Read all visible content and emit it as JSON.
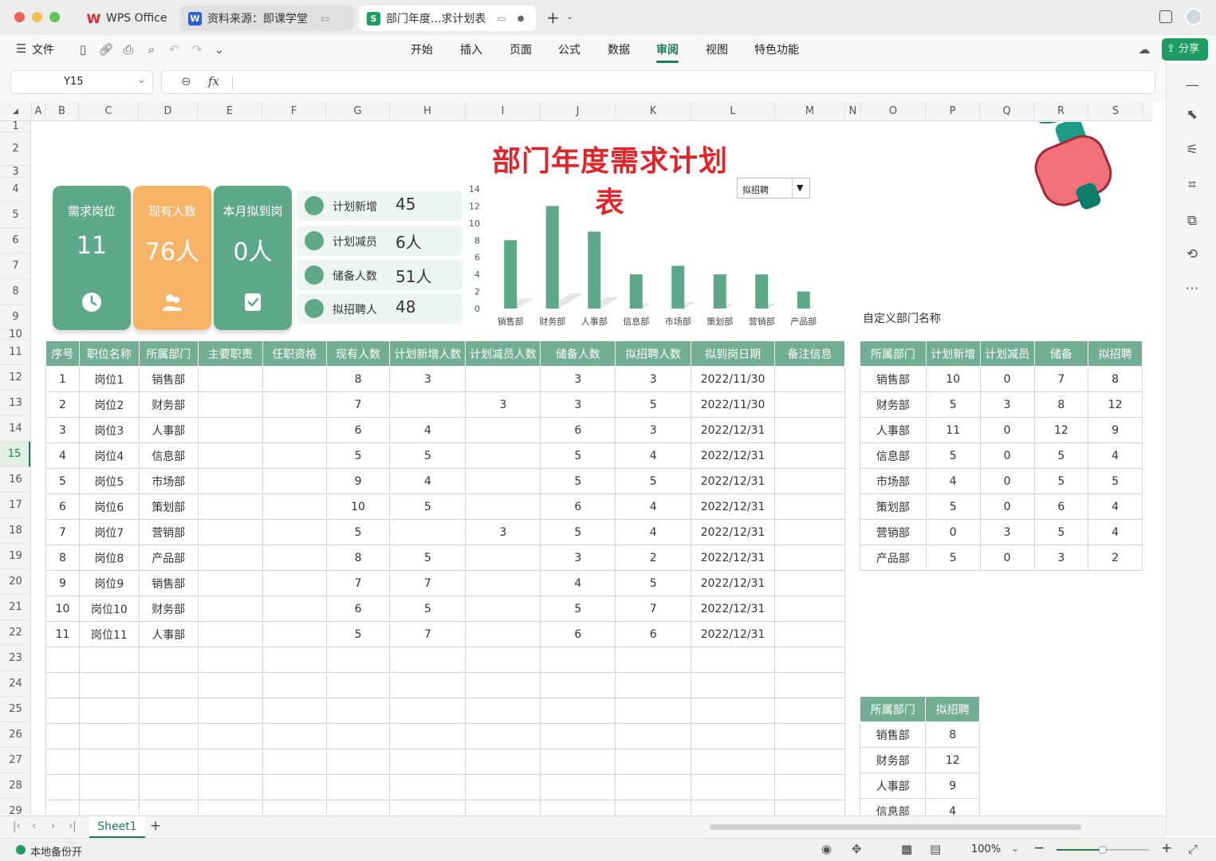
{
  "tabs": [
    {
      "label": "WPS Office",
      "icon": "wps-logo-icon"
    },
    {
      "label": "资料来源：即课学堂",
      "icon": "word-doc-icon"
    },
    {
      "label": "部门年度...求计划表",
      "icon": "sheet-doc-icon"
    }
  ],
  "menu": {
    "file": "文件",
    "items": [
      "开始",
      "插入",
      "页面",
      "公式",
      "数据",
      "审阅",
      "视图",
      "特色功能"
    ],
    "active": "审阅",
    "share": "分享"
  },
  "formula": {
    "cell_ref": "Y15",
    "fx": "fx",
    "value": ""
  },
  "columns": [
    "A",
    "B",
    "C",
    "D",
    "E",
    "F",
    "G",
    "H",
    "I",
    "J",
    "K",
    "L",
    "M",
    "N",
    "O",
    "P",
    "Q",
    "R",
    "S"
  ],
  "rows": [
    "1",
    "2",
    "3",
    "4",
    "5",
    "6",
    "7",
    "8",
    "9",
    "10",
    "11",
    "12",
    "13",
    "14",
    "15",
    "16",
    "17",
    "18",
    "19",
    "20",
    "21",
    "22",
    "23",
    "24",
    "25",
    "26",
    "27",
    "28",
    "29"
  ],
  "selected_row": "15",
  "title": "部门年度需求计划表",
  "kpis": [
    {
      "label": "需求岗位",
      "value": "11",
      "icon": "clock-icon",
      "color": "#5da88a"
    },
    {
      "label": "现有人数",
      "value": "76人",
      "icon": "people-icon",
      "color": "#f8b466"
    },
    {
      "label": "本月拟到岗",
      "value": "0人",
      "icon": "badge-check-icon",
      "color": "#5da88a"
    }
  ],
  "stats": [
    {
      "label": "计划新增",
      "value": "45",
      "icon": "chart-icon"
    },
    {
      "label": "计划减员",
      "value": "6人",
      "icon": "send-icon"
    },
    {
      "label": "储备人数",
      "value": "51人",
      "icon": "paper-plane-icon"
    },
    {
      "label": "拟招聘人",
      "value": "48",
      "icon": "grid-icon"
    }
  ],
  "dropdown": {
    "value": "拟招聘"
  },
  "chart_data": {
    "type": "bar",
    "categories": [
      "销售部",
      "财务部",
      "人事部",
      "信息部",
      "市场部",
      "策划部",
      "营销部",
      "产品部"
    ],
    "values": [
      8,
      12,
      9,
      4,
      5,
      4,
      4,
      2
    ],
    "yticks": [
      "14",
      "12",
      "10",
      "8",
      "6",
      "4",
      "2",
      "0"
    ],
    "ylim": [
      0,
      14
    ],
    "bar_color": "#5da88a"
  },
  "main_table": {
    "headers": [
      "序号",
      "职位名称",
      "所属部门",
      "主要职责",
      "任职资格",
      "现有人数",
      "计划新增人数",
      "计划减员人数",
      "储备人数",
      "拟招聘人数",
      "拟到岗日期",
      "备注信息"
    ],
    "rows": [
      [
        "1",
        "岗位1",
        "销售部",
        "",
        "",
        "8",
        "3",
        "",
        "3",
        "3",
        "2022/11/30",
        ""
      ],
      [
        "2",
        "岗位2",
        "财务部",
        "",
        "",
        "7",
        "",
        "3",
        "3",
        "5",
        "2022/11/30",
        ""
      ],
      [
        "3",
        "岗位3",
        "人事部",
        "",
        "",
        "6",
        "4",
        "",
        "6",
        "3",
        "2022/12/31",
        ""
      ],
      [
        "4",
        "岗位4",
        "信息部",
        "",
        "",
        "5",
        "5",
        "",
        "5",
        "4",
        "2022/12/31",
        ""
      ],
      [
        "5",
        "岗位5",
        "市场部",
        "",
        "",
        "9",
        "4",
        "",
        "5",
        "5",
        "2022/12/31",
        ""
      ],
      [
        "6",
        "岗位6",
        "策划部",
        "",
        "",
        "10",
        "5",
        "",
        "6",
        "4",
        "2022/12/31",
        ""
      ],
      [
        "7",
        "岗位7",
        "营销部",
        "",
        "",
        "5",
        "",
        "3",
        "5",
        "4",
        "2022/12/31",
        ""
      ],
      [
        "8",
        "岗位8",
        "产品部",
        "",
        "",
        "8",
        "5",
        "",
        "3",
        "2",
        "2022/12/31",
        ""
      ],
      [
        "9",
        "岗位9",
        "销售部",
        "",
        "",
        "7",
        "7",
        "",
        "4",
        "5",
        "2022/12/31",
        ""
      ],
      [
        "10",
        "岗位10",
        "财务部",
        "",
        "",
        "6",
        "5",
        "",
        "5",
        "7",
        "2022/12/31",
        ""
      ],
      [
        "11",
        "岗位11",
        "人事部",
        "",
        "",
        "5",
        "7",
        "",
        "6",
        "6",
        "2022/12/31",
        ""
      ]
    ]
  },
  "side_label": "自定义部门名称",
  "dept_table": {
    "headers": [
      "所属部门",
      "计划新增",
      "计划减员",
      "储备",
      "拟招聘"
    ],
    "rows": [
      [
        "销售部",
        "10",
        "0",
        "7",
        "8"
      ],
      [
        "财务部",
        "5",
        "3",
        "8",
        "12"
      ],
      [
        "人事部",
        "11",
        "0",
        "12",
        "9"
      ],
      [
        "信息部",
        "5",
        "0",
        "5",
        "4"
      ],
      [
        "市场部",
        "4",
        "0",
        "5",
        "5"
      ],
      [
        "策划部",
        "5",
        "0",
        "6",
        "4"
      ],
      [
        "营销部",
        "0",
        "3",
        "5",
        "4"
      ],
      [
        "产品部",
        "5",
        "0",
        "3",
        "2"
      ]
    ]
  },
  "small_table": {
    "headers": [
      "所属部门",
      "拟招聘"
    ],
    "rows": [
      [
        "销售部",
        "8"
      ],
      [
        "财务部",
        "12"
      ],
      [
        "人事部",
        "9"
      ],
      [
        "信息部",
        "4"
      ]
    ]
  },
  "sheet": {
    "name": "Sheet1"
  },
  "status": {
    "backup": "本地备份开",
    "zoom": "100%"
  }
}
